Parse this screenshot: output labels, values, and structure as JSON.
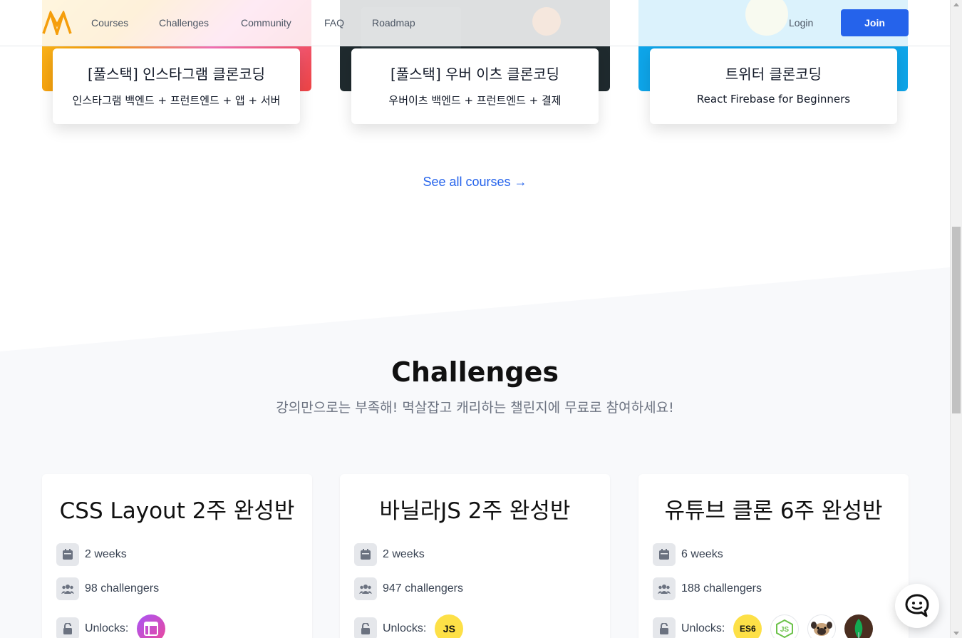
{
  "header": {
    "nav": [
      "Courses",
      "Challenges",
      "Community",
      "FAQ",
      "Roadmap"
    ],
    "login": "Login",
    "join": "Join"
  },
  "courses": [
    {
      "title": "[풀스택] 인스타그램 클론코딩",
      "subtitle": "인스타그램 백엔드 + 프런트엔드 + 앱 + 서버"
    },
    {
      "title": "[풀스택] 우버 이츠 클론코딩",
      "subtitle": "우버이츠 백엔드 + 프런트엔드 + 결제"
    },
    {
      "title": "트위터 클론코딩",
      "subtitle": "React Firebase for Beginners"
    }
  ],
  "see_all": "See all courses →",
  "challenges_section": {
    "title": "Challenges",
    "subtitle": "강의만으로는 부족해! 멱살잡고 캐리하는 챌린지에 무료로 참여하세요!"
  },
  "challenges": [
    {
      "title": "CSS Layout 2주 완성반",
      "duration": "2 weeks",
      "challengers": "98 challengers",
      "unlocks": "Unlocks:",
      "badges": [
        "layout-icon"
      ]
    },
    {
      "title": "바닐라JS 2주 완성반",
      "duration": "2 weeks",
      "challengers": "947 challengers",
      "unlocks": "Unlocks:",
      "badges": [
        "JS"
      ]
    },
    {
      "title": "유튜브 클론 6주 완성반",
      "duration": "6 weeks",
      "challengers": "188 challengers",
      "unlocks": "Unlocks:",
      "badges": [
        "ES6",
        "JS",
        "pug-icon",
        "mongodb-leaf-icon"
      ]
    }
  ],
  "colors": {
    "accent": "#2563eb",
    "logo": "#f59e0b",
    "badge_js": "#fde047"
  }
}
